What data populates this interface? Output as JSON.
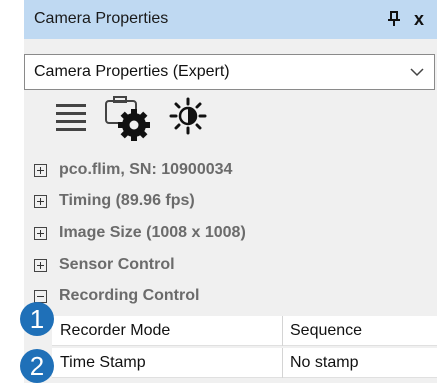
{
  "window": {
    "title": "Camera Properties",
    "pin_icon": "pin-icon",
    "pin_glyph": "ᵽ",
    "close_glyph": "x"
  },
  "selector": {
    "value": "Camera Properties (Expert)",
    "arrow_icon": "chevron-down-icon"
  },
  "toolbar": {
    "icons": [
      "menu-icon",
      "camera-settings-icon",
      "brightness-icon"
    ]
  },
  "tree": [
    {
      "label": "pco.flim, SN: 10900034",
      "expanded": false
    },
    {
      "label": "Timing (89.96 fps)",
      "expanded": false
    },
    {
      "label": "Image Size (1008 x 1008)",
      "expanded": false
    },
    {
      "label": "Sensor Control",
      "expanded": false
    },
    {
      "label": "Recording Control",
      "expanded": true
    }
  ],
  "properties": [
    {
      "name": "Recorder Mode",
      "value": "Sequence"
    },
    {
      "name": "Time Stamp",
      "value": "No stamp"
    }
  ],
  "callouts": [
    "1",
    "2"
  ],
  "colors": {
    "titlebar": "#bfd9f2",
    "panel": "#f0f0f0",
    "callout": "#1f70b8",
    "tree_text": "#6b6b6b"
  }
}
